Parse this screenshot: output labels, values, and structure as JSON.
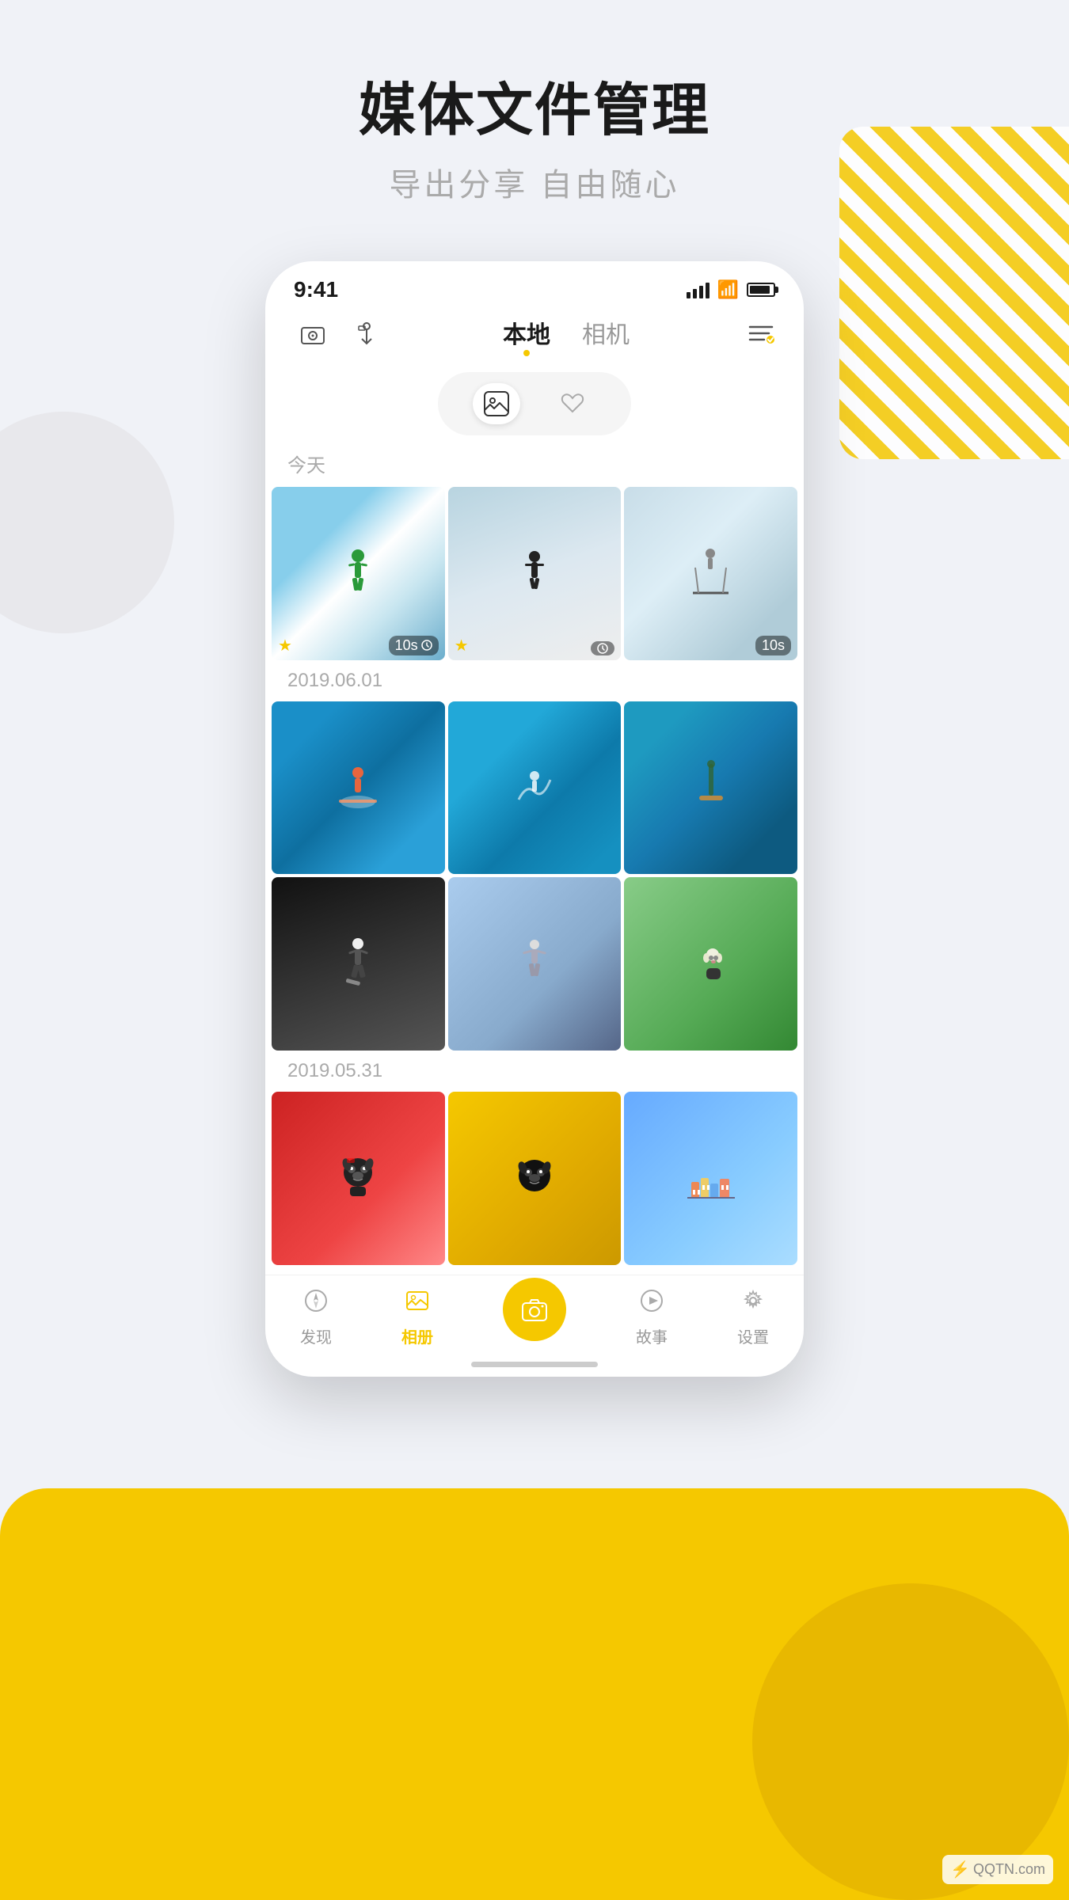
{
  "page": {
    "title": "媒体文件管理",
    "subtitle": "导出分享 自由随心",
    "background_color": "#f0f2f7",
    "accent_color": "#f5c800"
  },
  "status_bar": {
    "time": "9:41",
    "signal_strength": 4,
    "wifi": true,
    "battery": 90
  },
  "nav": {
    "tab_local": "本地",
    "tab_camera": "相机",
    "active_tab": "local"
  },
  "toggle": {
    "photos_label": "photos",
    "favorites_label": "favorites",
    "active": "photos"
  },
  "sections": [
    {
      "date_label": "今天",
      "photos": [
        {
          "id": "snow1",
          "type": "video",
          "duration": "10s",
          "starred": true
        },
        {
          "id": "snow2",
          "type": "video",
          "starred": true
        },
        {
          "id": "ski",
          "type": "video",
          "duration": "10s",
          "starred": false
        }
      ]
    },
    {
      "date_label": "2019.06.01",
      "photos": [
        {
          "id": "surf1",
          "type": "photo"
        },
        {
          "id": "surf2",
          "type": "photo"
        },
        {
          "id": "surf3",
          "type": "photo"
        },
        {
          "id": "skate1",
          "type": "photo"
        },
        {
          "id": "skate2",
          "type": "photo"
        },
        {
          "id": "dog",
          "type": "photo"
        }
      ]
    },
    {
      "date_label": "2019.05.31",
      "photos": [
        {
          "id": "pug1",
          "type": "photo"
        },
        {
          "id": "pug2",
          "type": "photo"
        },
        {
          "id": "town",
          "type": "photo"
        }
      ]
    }
  ],
  "bottom_nav": {
    "items": [
      {
        "id": "discover",
        "label": "发现",
        "icon": "compass"
      },
      {
        "id": "album",
        "label": "相册",
        "icon": "image",
        "active": true
      },
      {
        "id": "camera",
        "label": "",
        "icon": "camera",
        "is_camera": true
      },
      {
        "id": "story",
        "label": "故事",
        "icon": "play"
      },
      {
        "id": "settings",
        "label": "设置",
        "icon": "gear"
      }
    ]
  },
  "watermark": {
    "text": "QQTN.com",
    "icon": "⚡"
  }
}
